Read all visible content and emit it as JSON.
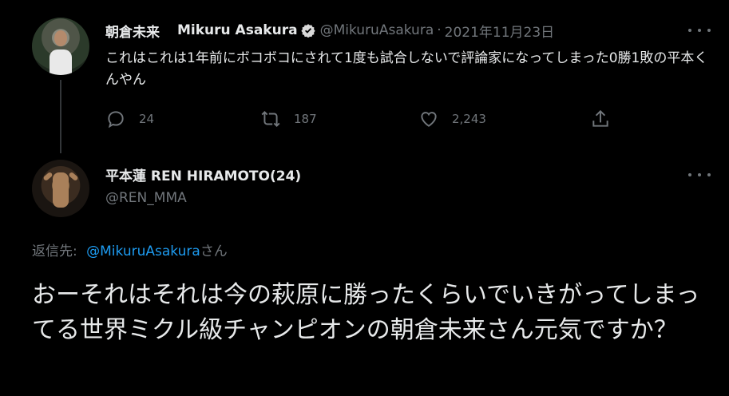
{
  "tweet1": {
    "display_name": "朝倉未来",
    "name_latin": "Mikuru Asakura",
    "handle": "@MikuruAsakura",
    "separator": "·",
    "date": "2021年11月23日",
    "text": "これはこれは1年前にボコボコにされて1度も試合しないで評論家になってしまった0勝1敗の平本くんやん",
    "reply_count": "24",
    "retweet_count": "187",
    "like_count": "2,243"
  },
  "tweet2": {
    "display_name": "平本蓮 REN HIRAMOTO(24)",
    "handle": "@REN_MMA",
    "reply_prefix": "返信先:",
    "reply_target": "@MikuruAsakura",
    "reply_suffix": "さん",
    "text": "おーそれはそれは今の萩原に勝ったくらいでいきがってしまってる世界ミクル級チャンピオンの朝倉未来さん元気ですか？"
  },
  "colors": {
    "background": "#000000",
    "primary_text": "#e7e9ea",
    "muted_text": "#71767b",
    "link": "#1d9bf0"
  },
  "icons": {
    "verified": "verified-badge-icon",
    "reply": "reply-bubble-icon",
    "retweet": "retweet-icon",
    "like": "heart-icon",
    "share": "share-icon",
    "more": "more-dots-icon"
  }
}
